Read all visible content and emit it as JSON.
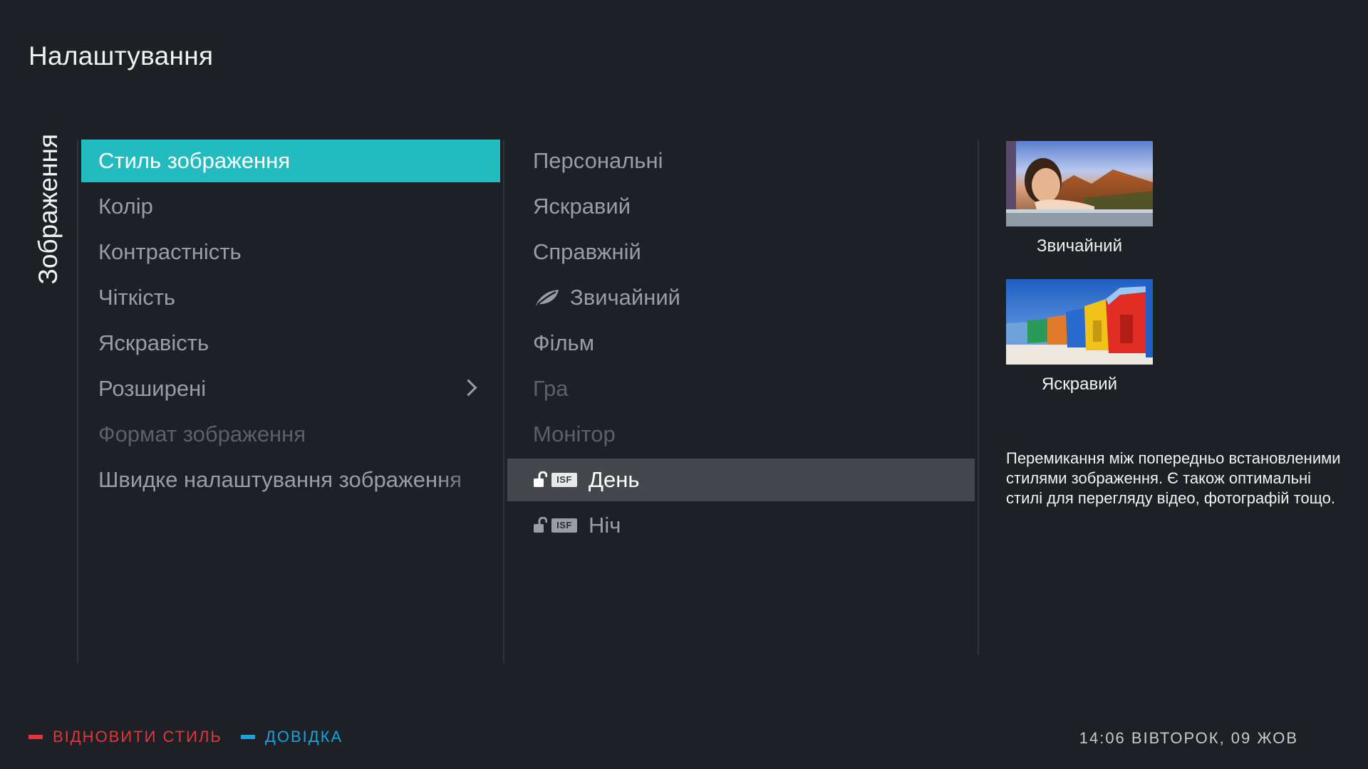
{
  "header": {
    "title": "Налаштування"
  },
  "section_tab": {
    "label": "Зображення"
  },
  "menu_main": {
    "items": [
      {
        "label": "Стиль зображення",
        "state": "active"
      },
      {
        "label": "Колір",
        "state": "normal"
      },
      {
        "label": "Контрастність",
        "state": "normal"
      },
      {
        "label": "Чіткість",
        "state": "normal"
      },
      {
        "label": "Яскравість",
        "state": "normal"
      },
      {
        "label": "Розширені",
        "state": "normal",
        "has_submenu": true
      },
      {
        "label": "Формат зображення",
        "state": "disabled"
      },
      {
        "label": "Швидке налаштування зображення",
        "state": "normal"
      }
    ]
  },
  "menu_styles": {
    "items": [
      {
        "label": "Персональні",
        "state": "normal"
      },
      {
        "label": "Яскравий",
        "state": "normal"
      },
      {
        "label": "Справжній",
        "state": "normal"
      },
      {
        "label": "Звичайний",
        "state": "normal",
        "icon": "eco-leaf-icon"
      },
      {
        "label": "Фільм",
        "state": "normal"
      },
      {
        "label": "Гра",
        "state": "disabled"
      },
      {
        "label": "Монітор",
        "state": "disabled"
      },
      {
        "label": "День",
        "state": "selected",
        "icon": "unlocked-lock-icon",
        "badge": "ISF"
      },
      {
        "label": "Ніч",
        "state": "normal",
        "icon": "unlocked-lock-icon",
        "badge": "ISF"
      }
    ]
  },
  "preview": {
    "thumbnails": [
      {
        "label": "Звичайний",
        "image": "girl-window-landscape-photo"
      },
      {
        "label": "Яскравий",
        "image": "colorful-beach-huts-photo"
      }
    ],
    "description": "Перемикання між попередньо встановленими стилями зображення. Є також оптимальні стилі для перегляду відео, фотографій тощо."
  },
  "footer": {
    "red_action": "ВІДНОВИТИ СТИЛЬ",
    "blue_action": "ДОВІДКА",
    "clock": "14:06 ВІВТОРОК, 09 ЖОВ"
  },
  "colors": {
    "background": "#1d2024",
    "accent_active": "#22bcc0",
    "selected_row": "#44484d",
    "red_key": "#e8333a",
    "blue_key": "#1aa2dc"
  }
}
